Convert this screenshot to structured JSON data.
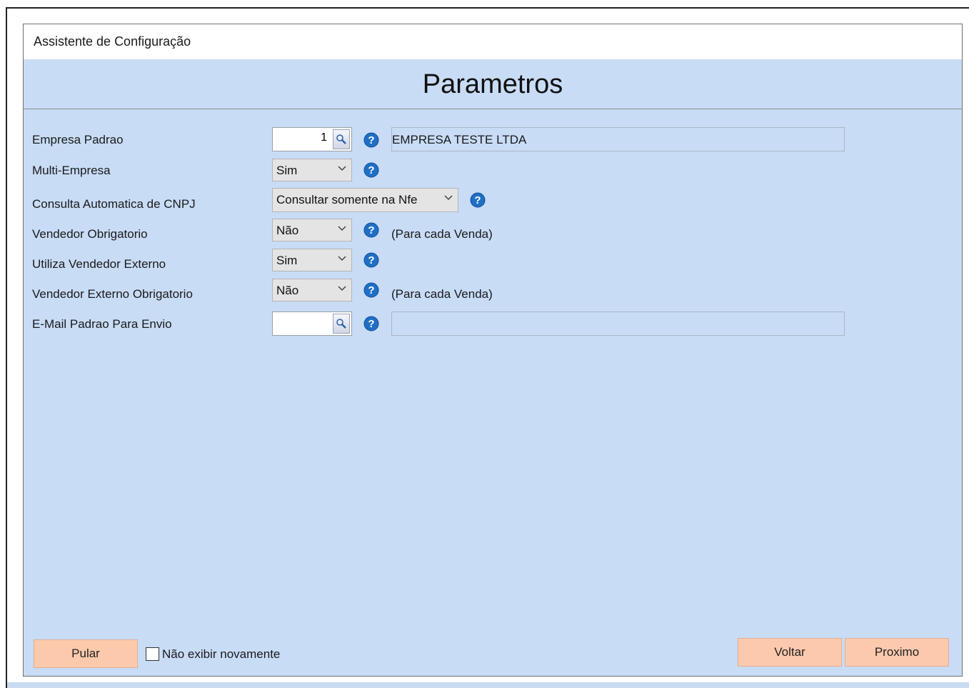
{
  "window": {
    "title": "Assistente de Configuração"
  },
  "page": {
    "heading": "Parametros"
  },
  "fields": {
    "empresa_padrao": {
      "label": "Empresa Padrao",
      "value": "1",
      "description": "EMPRESA TESTE LTDA"
    },
    "multi_empresa": {
      "label": "Multi-Empresa",
      "value": "Sim"
    },
    "consulta_cnpj": {
      "label": "Consulta Automatica de CNPJ",
      "value": "Consultar somente na Nfe"
    },
    "vendedor_obrigatorio": {
      "label": "Vendedor Obrigatorio",
      "value": "Não",
      "note": "(Para cada Venda)"
    },
    "utiliza_vendedor_externo": {
      "label": "Utiliza Vendedor Externo",
      "value": "Sim"
    },
    "vendedor_externo_obrigatorio": {
      "label": "Vendedor Externo Obrigatorio",
      "value": "Não",
      "note": "(Para cada Venda)"
    },
    "email_padrao": {
      "label": "E-Mail Padrao Para Envio",
      "value": "",
      "description": ""
    }
  },
  "footer": {
    "skip_label": "Pular",
    "dont_show_label": "Não exibir novamente",
    "dont_show_checked": false,
    "back_label": "Voltar",
    "next_label": "Proximo"
  },
  "colors": {
    "panel_bg": "#c8dcf6",
    "button_bg": "#fcc9ad",
    "help_icon": "#1f6fc5"
  },
  "icons": {
    "help": "help-icon",
    "lookup": "magnifier-icon",
    "dropdown": "chevron-down-icon"
  }
}
